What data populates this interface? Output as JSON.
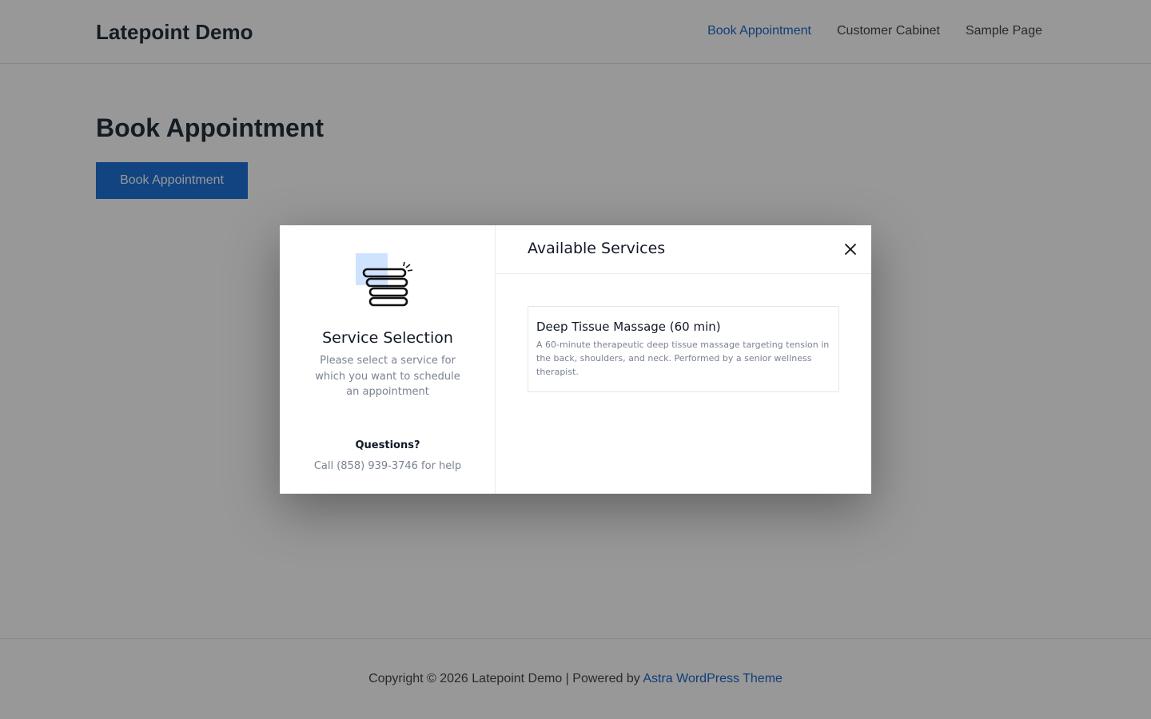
{
  "site": {
    "title": "Latepoint Demo",
    "nav": [
      {
        "label": "Book Appointment"
      },
      {
        "label": "Customer Cabinet"
      },
      {
        "label": "Sample Page"
      }
    ]
  },
  "page": {
    "title": "Book Appointment",
    "button_label": "Book Appointment"
  },
  "footer": {
    "text": "Copyright © 2026 Latepoint Demo | Powered by",
    "link": "Astra WordPress Theme"
  },
  "modal": {
    "side": {
      "icon": "service-list-icon",
      "title": "Service Selection",
      "description": "Please select a service for which you want to schedule an appointment",
      "questions": "Questions?",
      "call": "Call (858) 939-3746 for help"
    },
    "main": {
      "title": "Available Services",
      "close_icon": "close-icon",
      "services": [
        {
          "name": "Deep Tissue Massage (60 min)",
          "description": "A 60-minute therapeutic deep tissue massage targeting tension in the back, shoulders, and neck. Performed by a senior wellness therapist."
        }
      ]
    }
  },
  "colors": {
    "accent": "#0f6ad6",
    "link": "#0f5fc4",
    "icon_highlight": "#cfe3ff"
  }
}
